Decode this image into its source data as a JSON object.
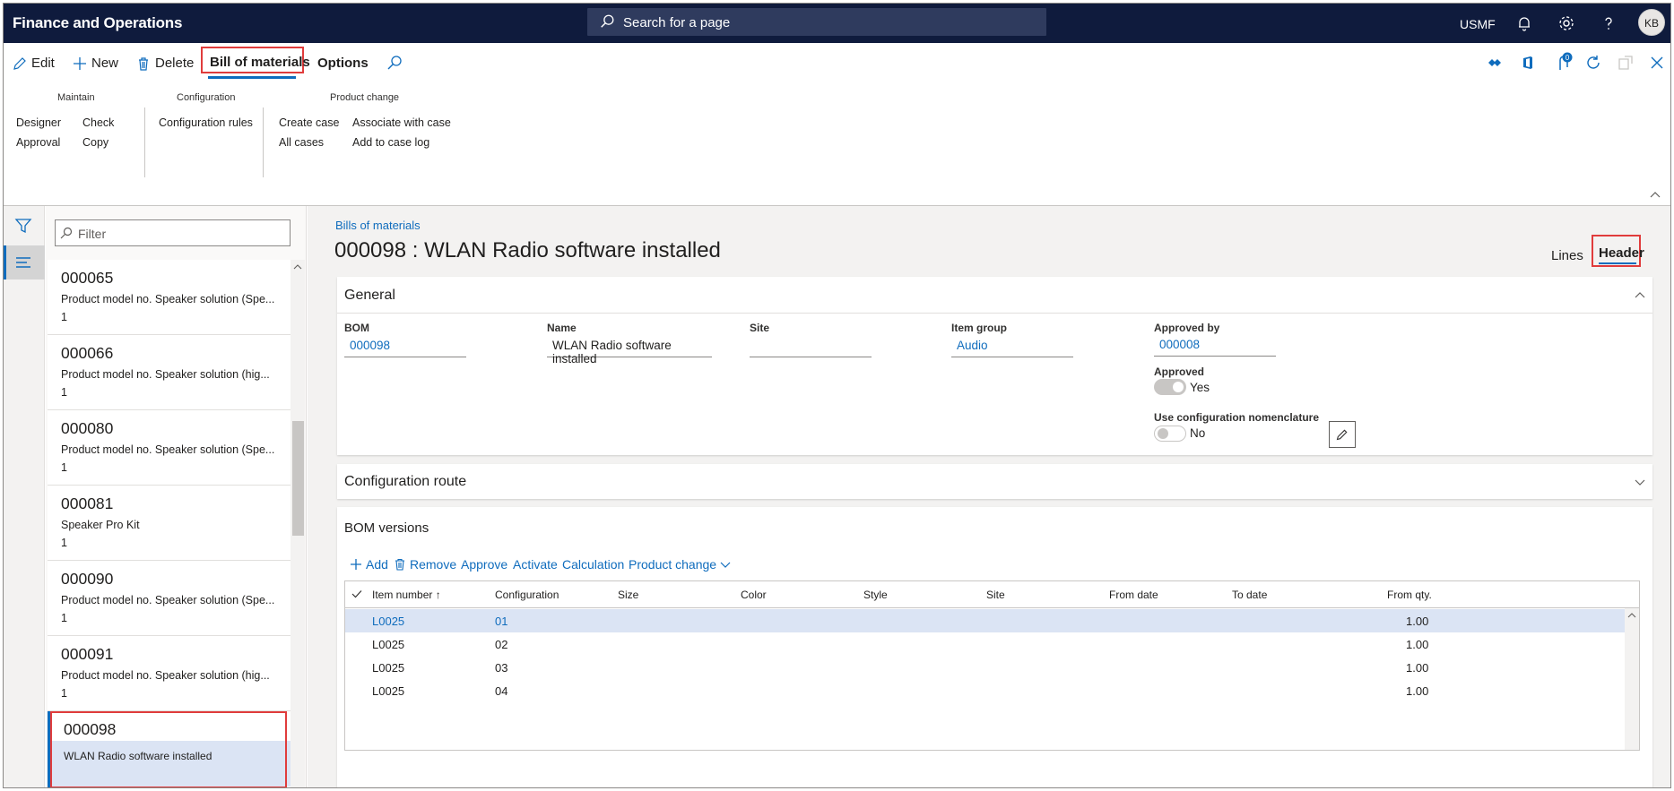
{
  "app": {
    "title": "Finance and Operations"
  },
  "search": {
    "placeholder": "Search for a page"
  },
  "topbar": {
    "company": "USMF",
    "avatar_initials": "KB",
    "notification_count": "0"
  },
  "actions": {
    "edit": "Edit",
    "new": "New",
    "delete": "Delete",
    "tab_bom": "Bill of materials",
    "tab_options": "Options"
  },
  "ribbon": {
    "groups": [
      {
        "title": "Maintain",
        "buttons": [
          "Designer",
          "Check",
          "Approval",
          "Copy"
        ]
      },
      {
        "title": "Configuration",
        "buttons": [
          "Configuration rules"
        ]
      },
      {
        "title": "Product change",
        "buttons": [
          "Create case",
          "Associate with case",
          "All cases",
          "Add to case log"
        ]
      }
    ]
  },
  "filter": {
    "placeholder": "Filter"
  },
  "list": {
    "items": [
      {
        "number": "000065",
        "desc": "Product model no. Speaker solution (Spe...",
        "qty": "1"
      },
      {
        "number": "000066",
        "desc": "Product model no. Speaker solution (hig...",
        "qty": "1"
      },
      {
        "number": "000080",
        "desc": "Product model no. Speaker solution (Spe...",
        "qty": "1"
      },
      {
        "number": "000081",
        "desc": "Speaker Pro Kit",
        "qty": "1"
      },
      {
        "number": "000090",
        "desc": "Product model no. Speaker solution (Spe...",
        "qty": "1"
      },
      {
        "number": "000091",
        "desc": "Product model no. Speaker solution (hig...",
        "qty": "1"
      },
      {
        "number": "000098",
        "desc": "WLAN Radio software installed",
        "qty": ""
      }
    ]
  },
  "main": {
    "breadcrumb": "Bills of materials",
    "title": "000098 : WLAN Radio software installed",
    "view_lines": "Lines",
    "view_header": "Header"
  },
  "general": {
    "heading": "General",
    "bom_label": "BOM",
    "bom_value": "000098",
    "name_label": "Name",
    "name_value": "WLAN Radio software installed",
    "site_label": "Site",
    "site_value": "",
    "itemgroup_label": "Item group",
    "itemgroup_value": "Audio",
    "approvedby_label": "Approved by",
    "approvedby_value": "000008",
    "approved_label": "Approved",
    "approved_value": "Yes",
    "nomenclature_label": "Use configuration nomenclature",
    "nomenclature_value": "No"
  },
  "config_route": {
    "heading": "Configuration route"
  },
  "bom_versions": {
    "heading": "BOM versions",
    "toolbar": {
      "add": "Add",
      "remove": "Remove",
      "approve": "Approve",
      "activate": "Activate",
      "calculation": "Calculation",
      "product_change": "Product change"
    },
    "columns": [
      "Item number",
      "Configuration",
      "Size",
      "Color",
      "Style",
      "Site",
      "From date",
      "To date",
      "From qty."
    ],
    "rows": [
      {
        "item": "L0025",
        "config": "01",
        "qty": "1.00"
      },
      {
        "item": "L0025",
        "config": "02",
        "qty": "1.00"
      },
      {
        "item": "L0025",
        "config": "03",
        "qty": "1.00"
      },
      {
        "item": "L0025",
        "config": "04",
        "qty": "1.00"
      }
    ]
  },
  "colors": {
    "navy": "#0f1b3d",
    "accent": "#0f6cbd",
    "highlight": "#e03c3c",
    "selection": "#dbe4f4"
  }
}
